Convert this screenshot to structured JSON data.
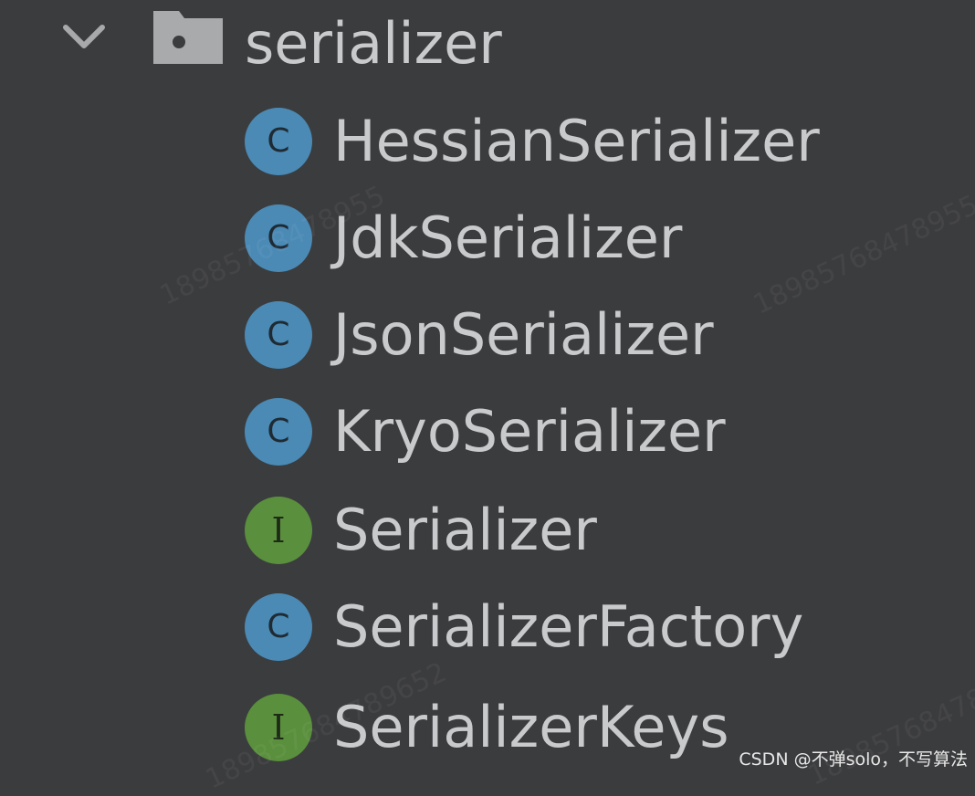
{
  "tree": {
    "folder": {
      "label": "serializer",
      "expand_icon": "chevron-down-icon",
      "icon": "folder-icon"
    },
    "items": [
      {
        "label": "HessianSerializer",
        "kind": "class",
        "badge": "C"
      },
      {
        "label": "JdkSerializer",
        "kind": "class",
        "badge": "C"
      },
      {
        "label": "JsonSerializer",
        "kind": "class",
        "badge": "C"
      },
      {
        "label": "KryoSerializer",
        "kind": "class",
        "badge": "C"
      },
      {
        "label": "Serializer",
        "kind": "interface",
        "badge": "I"
      },
      {
        "label": "SerializerFactory",
        "kind": "class",
        "badge": "C"
      },
      {
        "label": "SerializerKeys",
        "kind": "interface",
        "badge": "I"
      }
    ]
  },
  "watermark": {
    "text_1": "18985768478955",
    "text_2": "18985768478955",
    "text_3": "189857684789652",
    "text_4": "18985768478955"
  },
  "footer": {
    "credit": "CSDN @不弹solo，不写算法"
  },
  "colors": {
    "background": "#3b3c3e",
    "text": "#c8cacc",
    "class_badge": "#4a8ab5",
    "interface_badge": "#5a8f3d"
  }
}
